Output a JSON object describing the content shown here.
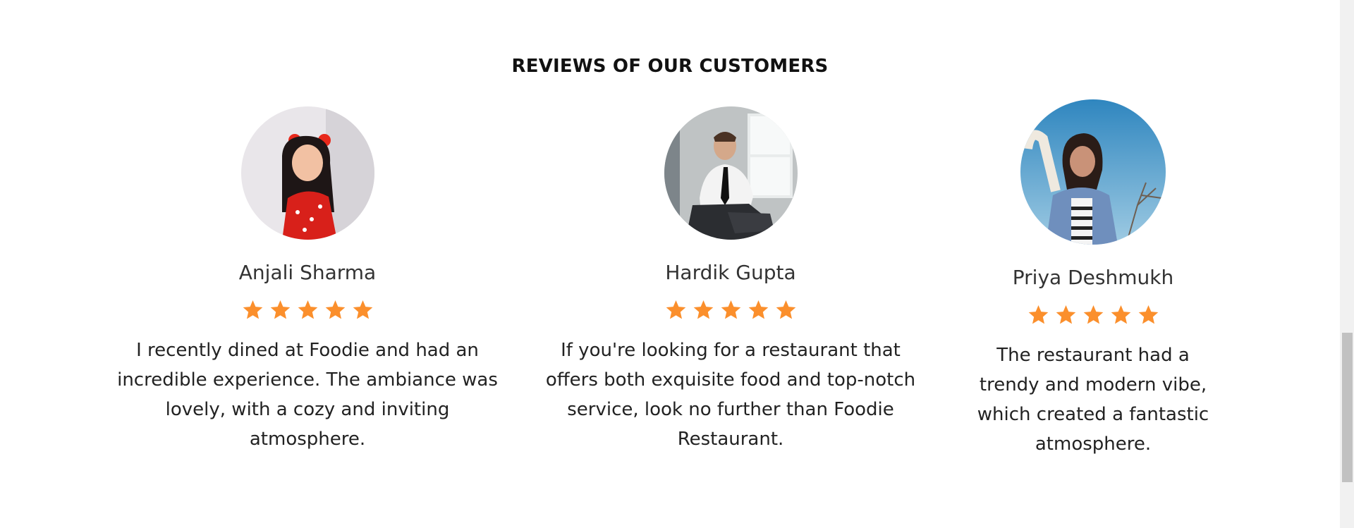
{
  "section": {
    "title": "REVIEWS OF OUR CUSTOMERS"
  },
  "reviews": [
    {
      "name": "Anjali Sharma",
      "rating": 5,
      "text": "I recently dined at Foodie and had an incredible experience. The ambiance was lovely, with a cozy and inviting atmosphere."
    },
    {
      "name": "Hardik Gupta",
      "rating": 5,
      "text": "If you're looking for a restaurant that offers both exquisite food and top-notch service, look no further than Foodie Restaurant."
    },
    {
      "name": "Priya Deshmukh",
      "rating": 5,
      "text": "The restaurant had a trendy and modern vibe, which created a fantastic atmosphere."
    }
  ],
  "colors": {
    "star": "#fb8f2c",
    "background": "#ffffff",
    "heading": "#111111"
  },
  "icons": {
    "rating": "star-icon"
  }
}
